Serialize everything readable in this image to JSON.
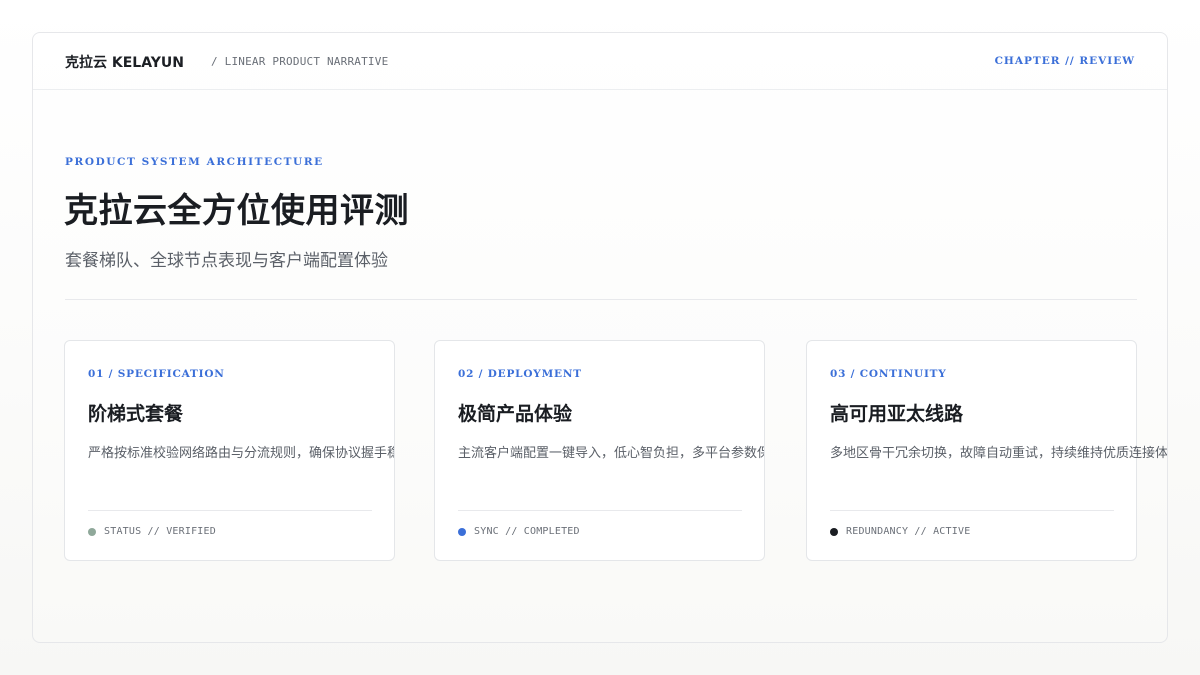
{
  "header": {
    "brand": "克拉云 KELAYUN",
    "tagline": "/ LINEAR PRODUCT NARRATIVE",
    "chapter": "CHAPTER // REVIEW"
  },
  "hero": {
    "eyebrow": "PRODUCT SYSTEM ARCHITECTURE",
    "title": "克拉云全方位使用评测",
    "subtitle": "套餐梯队、全球节点表现与客户端配置体验"
  },
  "cards": [
    {
      "label": "01 / SPECIFICATION",
      "title": "阶梯式套餐",
      "desc": "严格按标准校验网络路由与分流规则，确保协议握手稳定",
      "status": "STATUS // VERIFIED",
      "dot_color": "#8fa89a"
    },
    {
      "label": "02 / DEPLOYMENT",
      "title": "极简产品体验",
      "desc": "主流客户端配置一键导入，低心智负担，多平台参数保持",
      "status": "SYNC // COMPLETED",
      "dot_color": "#3b6fd8"
    },
    {
      "label": "03 / CONTINUITY",
      "title": "高可用亚太线路",
      "desc": "多地区骨干冗余切换，故障自动重试，持续维持优质连接体验",
      "status": "REDUNDANCY // ACTIVE",
      "dot_color": "#1a1d22"
    }
  ],
  "colors": {
    "accent": "#3b6fd8",
    "text": "#1a1d22",
    "muted": "#5b6068"
  }
}
